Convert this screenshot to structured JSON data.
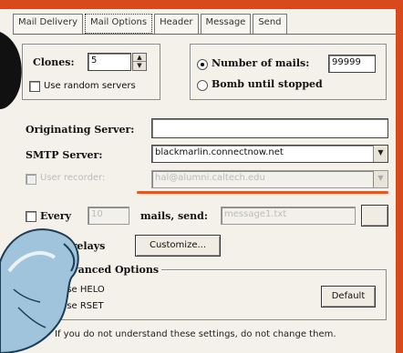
{
  "tabs": [
    {
      "label": "Mail Delivery"
    },
    {
      "label": "Mail Options",
      "active": true
    },
    {
      "label": "Header"
    },
    {
      "label": "Message"
    },
    {
      "label": "Send"
    }
  ],
  "clones": {
    "label": "Clones:",
    "value": "5"
  },
  "random_servers": {
    "label": "Use random servers",
    "checked": false
  },
  "mode": {
    "number_of_mails_label": "Number of mails:",
    "number_of_mails_value": "99999",
    "bomb_until_stopped_label": "Bomb until stopped",
    "selected": "number_of_mails"
  },
  "originating_server": {
    "label": "Originating Server:",
    "value": ""
  },
  "smtp_server": {
    "label": "SMTP Server:",
    "value": "blackmarlin.connectnow.net"
  },
  "user_recorder": {
    "label": "User recorder:",
    "value": "hal@alumni.caltech.edu",
    "enabled": false
  },
  "every": {
    "label": "Every",
    "value": "10",
    "mails_send_label": "mails, send:",
    "file": "message1.txt"
  },
  "relays": {
    "label": "Use relays",
    "customize_label": "Customize..."
  },
  "advanced": {
    "title": "Advanced Options",
    "helo_label": "Use HELO",
    "helo_checked": true,
    "rset_label": "Use RSET",
    "rset_checked": true,
    "default_label": "Default"
  },
  "note": "If you do not understand these settings, do not change them.",
  "colors": {
    "accent": "#d84a1d",
    "background": "#f4f1ea"
  }
}
